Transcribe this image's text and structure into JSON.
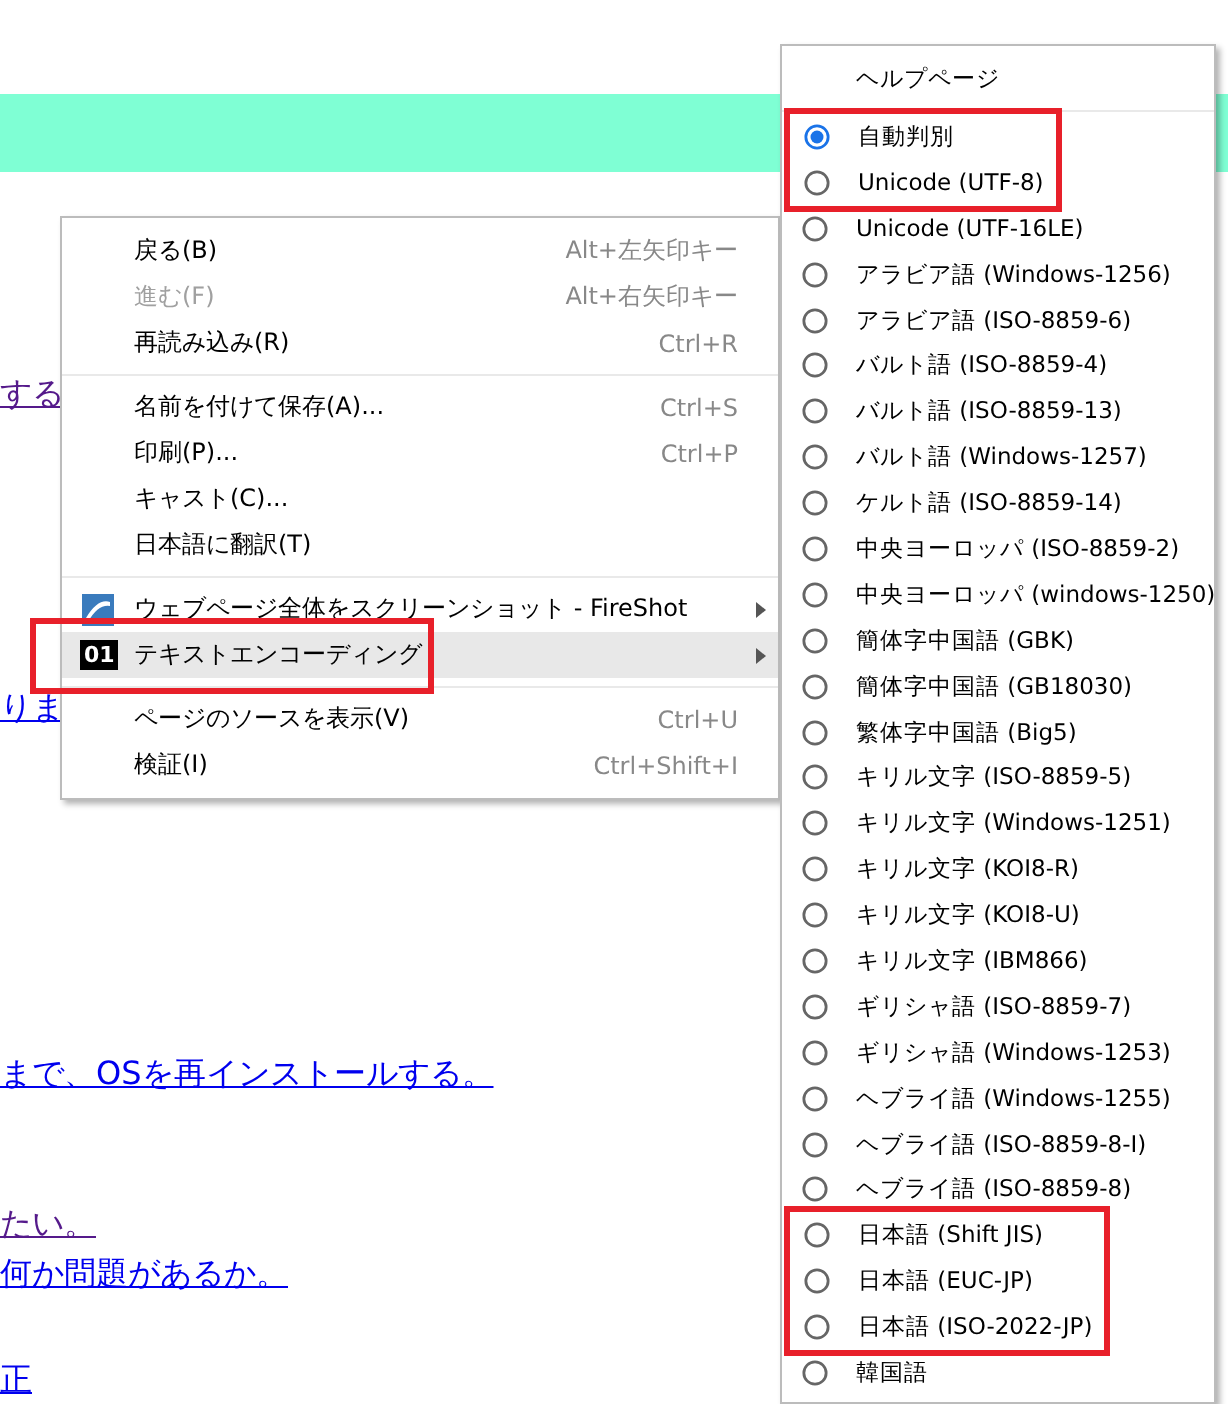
{
  "page": {
    "links": [
      {
        "text": "する",
        "visited": true
      },
      {
        "text": "りま",
        "visited": false
      },
      {
        "text": "まで、OSを再インストールする。",
        "visited": false
      },
      {
        "text": "たい。",
        "visited": true
      },
      {
        "text": "何か問題があるか。",
        "visited": false
      },
      {
        "text": "正",
        "visited": false
      }
    ]
  },
  "context_menu": {
    "groups": [
      [
        {
          "label": "戻る(B)",
          "shortcut": "Alt+左矢印キー",
          "disabled": false
        },
        {
          "label": "進む(F)",
          "shortcut": "Alt+右矢印キー",
          "disabled": true
        },
        {
          "label": "再読み込み(R)",
          "shortcut": "Ctrl+R",
          "disabled": false
        }
      ],
      [
        {
          "label": "名前を付けて保存(A)...",
          "shortcut": "Ctrl+S",
          "disabled": false
        },
        {
          "label": "印刷(P)...",
          "shortcut": "Ctrl+P",
          "disabled": false
        },
        {
          "label": "キャスト(C)...",
          "disabled": false
        },
        {
          "label": "日本語に翻訳(T)",
          "disabled": false
        }
      ],
      [
        {
          "label": "ウェブページ全体をスクリーンショット - FireShot",
          "disabled": false,
          "kind": "app",
          "submenu": true,
          "hovered": false,
          "highlighted": false
        },
        {
          "label": "テキストエンコーディング",
          "disabled": false,
          "kind": "badge",
          "icon_text": "01",
          "submenu": true,
          "hovered": true,
          "highlighted": true
        }
      ],
      [
        {
          "label": "ページのソースを表示(V)",
          "shortcut": "Ctrl+U",
          "disabled": false
        },
        {
          "label": "検証(I)",
          "shortcut": "Ctrl+Shift+I",
          "disabled": false
        }
      ]
    ]
  },
  "encoding_menu": {
    "help": "ヘルプページ",
    "options": [
      {
        "label": "自動判別",
        "selected": true,
        "highlighted": true
      },
      {
        "label": "Unicode (UTF-8)",
        "selected": false,
        "highlighted": true
      },
      {
        "label": "Unicode (UTF-16LE)",
        "selected": false,
        "highlighted": false
      },
      {
        "label": "アラビア語 (Windows-1256)",
        "selected": false,
        "highlighted": false
      },
      {
        "label": "アラビア語 (ISO-8859-6)",
        "selected": false,
        "highlighted": false
      },
      {
        "label": "バルト語 (ISO-8859-4)",
        "selected": false,
        "highlighted": false
      },
      {
        "label": "バルト語 (ISO-8859-13)",
        "selected": false,
        "highlighted": false
      },
      {
        "label": "バルト語 (Windows-1257)",
        "selected": false,
        "highlighted": false
      },
      {
        "label": "ケルト語 (ISO-8859-14)",
        "selected": false,
        "highlighted": false
      },
      {
        "label": "中央ヨーロッパ (ISO-8859-2)",
        "selected": false,
        "highlighted": false
      },
      {
        "label": "中央ヨーロッパ (windows-1250)",
        "selected": false,
        "highlighted": false
      },
      {
        "label": "簡体字中国語 (GBK)",
        "selected": false,
        "highlighted": false
      },
      {
        "label": "簡体字中国語 (GB18030)",
        "selected": false,
        "highlighted": false
      },
      {
        "label": "繁体字中国語 (Big5)",
        "selected": false,
        "highlighted": false
      },
      {
        "label": "キリル文字 (ISO-8859-5)",
        "selected": false,
        "highlighted": false
      },
      {
        "label": "キリル文字 (Windows-1251)",
        "selected": false,
        "highlighted": false
      },
      {
        "label": "キリル文字 (KOI8-R)",
        "selected": false,
        "highlighted": false
      },
      {
        "label": "キリル文字 (KOI8-U)",
        "selected": false,
        "highlighted": false
      },
      {
        "label": "キリル文字 (IBM866)",
        "selected": false,
        "highlighted": false
      },
      {
        "label": "ギリシャ語 (ISO-8859-7)",
        "selected": false,
        "highlighted": false
      },
      {
        "label": "ギリシャ語 (Windows-1253)",
        "selected": false,
        "highlighted": false
      },
      {
        "label": "ヘブライ語 (Windows-1255)",
        "selected": false,
        "highlighted": false
      },
      {
        "label": "ヘブライ語 (ISO-8859-8-I)",
        "selected": false,
        "highlighted": false
      },
      {
        "label": "ヘブライ語 (ISO-8859-8)",
        "selected": false,
        "highlighted": false
      },
      {
        "label": "日本語 (Shift JIS)",
        "selected": false,
        "highlighted": true
      },
      {
        "label": "日本語 (EUC-JP)",
        "selected": false,
        "highlighted": true
      },
      {
        "label": "日本語 (ISO-2022-JP)",
        "selected": false,
        "highlighted": true
      },
      {
        "label": "韓国語",
        "selected": false,
        "highlighted": false
      }
    ]
  }
}
